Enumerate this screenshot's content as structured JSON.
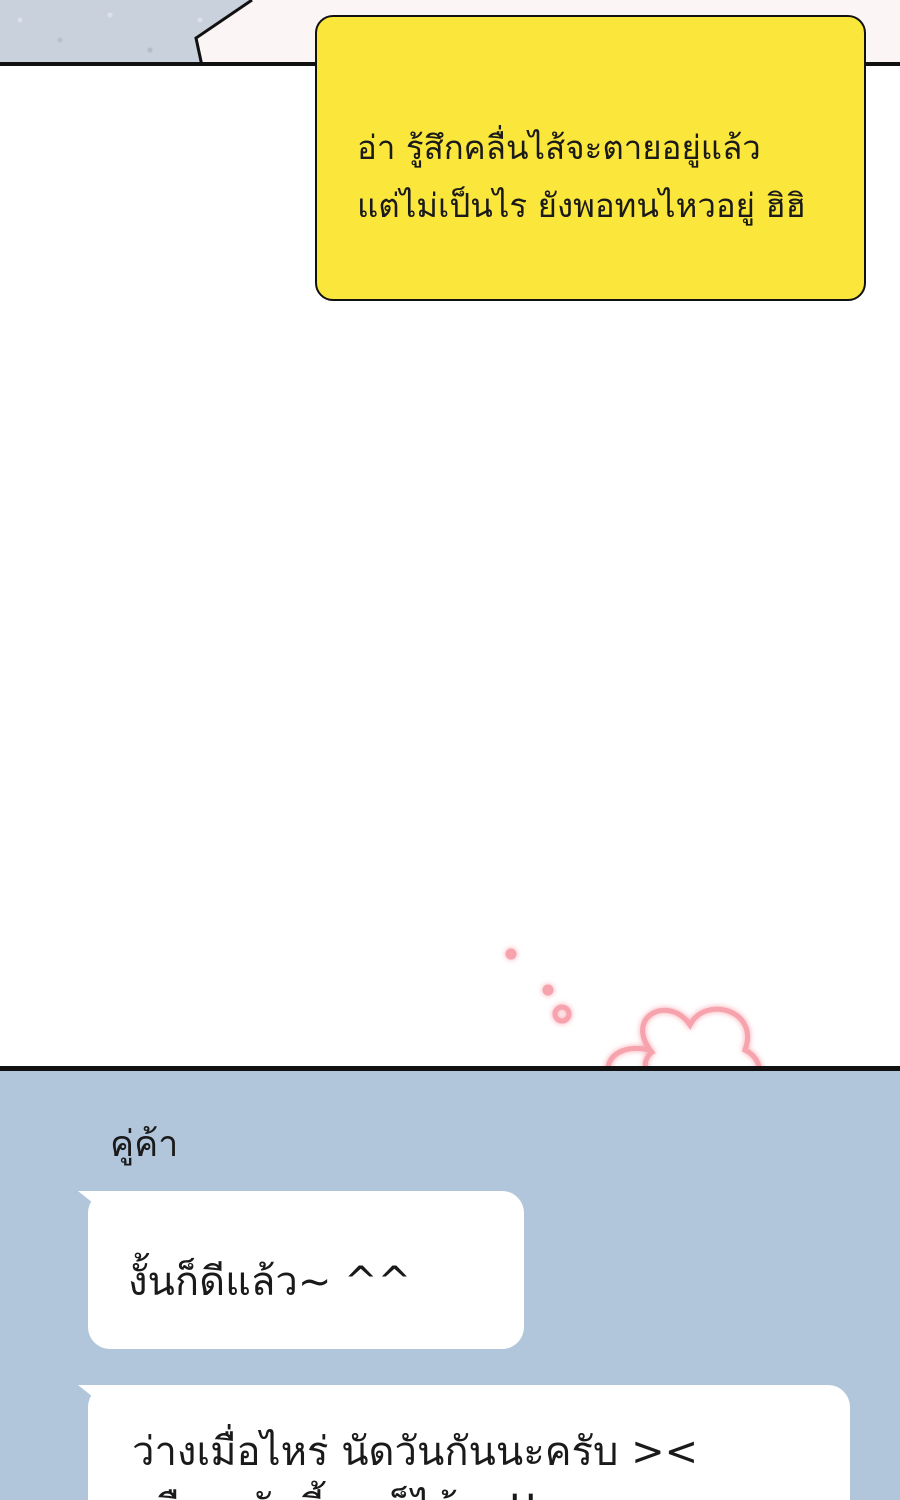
{
  "top_bubble": {
    "lines": [
      "อ่า รู้สึกคลื่นไส้จะตายอยู่แล้ว",
      "แต่ไม่เป็นไร ยังพอทนไหวอยู่ ฮิฮิ"
    ],
    "background": "#fbe73c"
  },
  "chat": {
    "background": "#b1c6da",
    "sender_name": "คู่ค้า",
    "messages": [
      {
        "lines": [
          "งั้นก็ดีแล้ว~ ^^"
        ]
      },
      {
        "lines": [
          "ว่างเมื่อไหร่ นัดวันกันนะครับ ><",
          "หรือจะวันนี้เลยก็ได้นะ!!"
        ]
      }
    ]
  },
  "icons": {
    "doodle": "flower-sparkle-icon",
    "doodle_color": "#f7a3ad"
  }
}
